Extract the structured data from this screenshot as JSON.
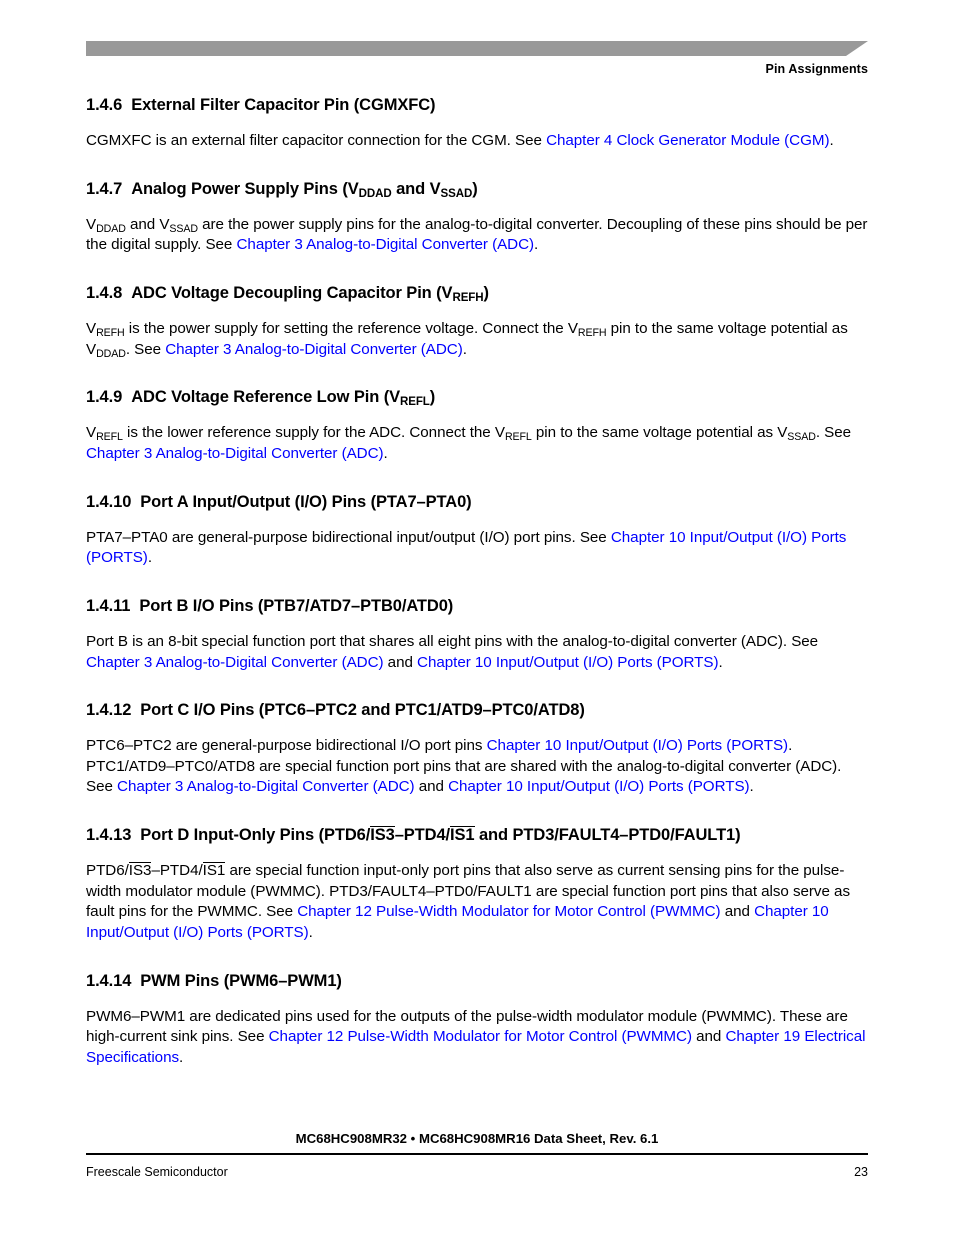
{
  "header": {
    "title": "Pin Assignments",
    "band_color": "#999999"
  },
  "colors": {
    "link": "#0000FF",
    "text": "#000000",
    "band": "#999999"
  },
  "sections": [
    {
      "number": "1.4.6",
      "title_prefix": "External Filter Capacitor Pin (CGMXFC)",
      "body_parts": [
        {
          "t": "CGMXFC is an external filter capacitor connection for the CGM. See ",
          "link": false
        },
        {
          "t": "Chapter 4 Clock Generator Module (CGM)",
          "link": true
        },
        {
          "t": ".",
          "link": false
        }
      ]
    },
    {
      "number": "1.4.7",
      "title_prefix": "Analog Power Supply Pins (V",
      "title_sub1": "DDAD",
      "title_mid": " and V",
      "title_sub2": "SSAD",
      "title_suffix": ")",
      "body_parts": [
        {
          "t": "V",
          "link": false
        },
        {
          "sub": "DDAD"
        },
        {
          "t": " and V",
          "link": false
        },
        {
          "sub": "SSAD"
        },
        {
          "t": " are the power supply pins for the analog-to-digital converter. Decoupling of these pins should be per the digital supply. See ",
          "link": false
        },
        {
          "t": "Chapter 3 Analog-to-Digital Converter (ADC)",
          "link": true
        },
        {
          "t": ".",
          "link": false
        }
      ]
    },
    {
      "number": "1.4.8",
      "title_prefix": "ADC Voltage Decoupling Capacitor Pin (V",
      "title_sub1": "REFH",
      "title_suffix": ")",
      "body_parts": [
        {
          "t": "V",
          "link": false
        },
        {
          "sub": "REFH"
        },
        {
          "t": " is the power supply for setting the reference voltage. Connect the V",
          "link": false
        },
        {
          "sub": "REFH"
        },
        {
          "t": " pin to the same voltage potential as V",
          "link": false
        },
        {
          "sub": "DDAD"
        },
        {
          "t": ". See ",
          "link": false
        },
        {
          "t": "Chapter 3 Analog-to-Digital Converter (ADC)",
          "link": true
        },
        {
          "t": ".",
          "link": false
        }
      ]
    },
    {
      "number": "1.4.9",
      "title_prefix": "ADC Voltage Reference Low Pin (V",
      "title_sub1": "REFL",
      "title_suffix": ")",
      "body_parts": [
        {
          "t": "V",
          "link": false
        },
        {
          "sub": "REFL"
        },
        {
          "t": " is the lower reference supply for the ADC. Connect the V",
          "link": false
        },
        {
          "sub": "REFL"
        },
        {
          "t": " pin to the same voltage potential as V",
          "link": false
        },
        {
          "sub": "SSAD"
        },
        {
          "t": ". See ",
          "link": false
        },
        {
          "t": "Chapter 3 Analog-to-Digital Converter (ADC)",
          "link": true
        },
        {
          "t": ".",
          "link": false
        }
      ]
    },
    {
      "number": "1.4.10",
      "title_prefix": "Port A Input/Output (I/O) Pins (PTA7–PTA0)",
      "body_parts": [
        {
          "t": "PTA7–PTA0 are general-purpose bidirectional input/output (I/O) port pins. See ",
          "link": false
        },
        {
          "t": "Chapter 10 Input/Output (I/O) Ports (PORTS)",
          "link": true
        },
        {
          "t": ".",
          "link": false
        }
      ]
    },
    {
      "number": "1.4.11",
      "title_prefix": "Port B I/O Pins (PTB7/ATD7–PTB0/ATD0)",
      "body_parts": [
        {
          "t": "Port B is an 8-bit special function port that shares all eight pins with the analog-to-digital converter (ADC). See ",
          "link": false
        },
        {
          "t": "Chapter 3 Analog-to-Digital Converter (ADC)",
          "link": true
        },
        {
          "t": " and ",
          "link": false
        },
        {
          "t": "Chapter 10 Input/Output (I/O) Ports (PORTS)",
          "link": true
        },
        {
          "t": ".",
          "link": false
        }
      ]
    },
    {
      "number": "1.4.12",
      "title_prefix": "Port C I/O Pins (PTC6–PTC2 and PTC1/ATD9–PTC0/ATD8)",
      "body_parts": [
        {
          "t": "PTC6–PTC2 are general-purpose bidirectional I/O port pins ",
          "link": false
        },
        {
          "t": "Chapter 10 Input/Output (I/O) Ports (PORTS)",
          "link": true
        },
        {
          "t": ". PTC1/ATD9–PTC0/ATD8 are special function port pins that are shared with the analog-to-digital converter (ADC). See ",
          "link": false
        },
        {
          "t": "Chapter 3 Analog-to-Digital Converter (ADC)",
          "link": true
        },
        {
          "t": " and ",
          "link": false
        },
        {
          "t": "Chapter 10 Input/Output (I/O) Ports (PORTS)",
          "link": true
        },
        {
          "t": ".",
          "link": false
        }
      ]
    },
    {
      "number": "1.4.13",
      "title_prefix": "Port D Input-Only Pins (PTD6/",
      "title_ovl1": "IS3",
      "title_mid": "–PTD4/",
      "title_ovl2": "IS1",
      "title_suffix": " and PTD3/FAULT4–PTD0/FAULT1)",
      "body_parts": [
        {
          "t": "PTD6/",
          "link": false
        },
        {
          "ovl": "IS3"
        },
        {
          "t": "–PTD4/",
          "link": false
        },
        {
          "ovl": "IS1"
        },
        {
          "t": " are special function input-only port pins that also serve as current sensing pins for the pulse-width modulator module (PWMMC). PTD3/FAULT4–PTD0/FAULT1 are special function port pins that also serve as fault pins for the PWMMC. See ",
          "link": false
        },
        {
          "t": "Chapter 12 Pulse-Width Modulator for Motor Control (PWMMC)",
          "link": true
        },
        {
          "t": " and ",
          "link": false
        },
        {
          "t": "Chapter 10 Input/Output (I/O) Ports (PORTS)",
          "link": true
        },
        {
          "t": ".",
          "link": false
        }
      ]
    },
    {
      "number": "1.4.14",
      "title_prefix": "PWM Pins (PWM6–PWM1)",
      "body_parts": [
        {
          "t": "PWM6–PWM1 are dedicated pins used for the outputs of the pulse-width modulator module (PWMMC). These are high-current sink pins. See ",
          "link": false
        },
        {
          "t": "Chapter 12 Pulse-Width Modulator for Motor Control (PWMMC)",
          "link": true
        },
        {
          "t": " and ",
          "link": false
        },
        {
          "t": "Chapter 19 Electrical Specifications",
          "link": true
        },
        {
          "t": ".",
          "link": false
        }
      ]
    }
  ],
  "footer": {
    "document_title": "MC68HC908MR32 • MC68HC908MR16 Data Sheet, Rev. 6.1",
    "company": "Freescale Semiconductor",
    "page_number": "23"
  }
}
